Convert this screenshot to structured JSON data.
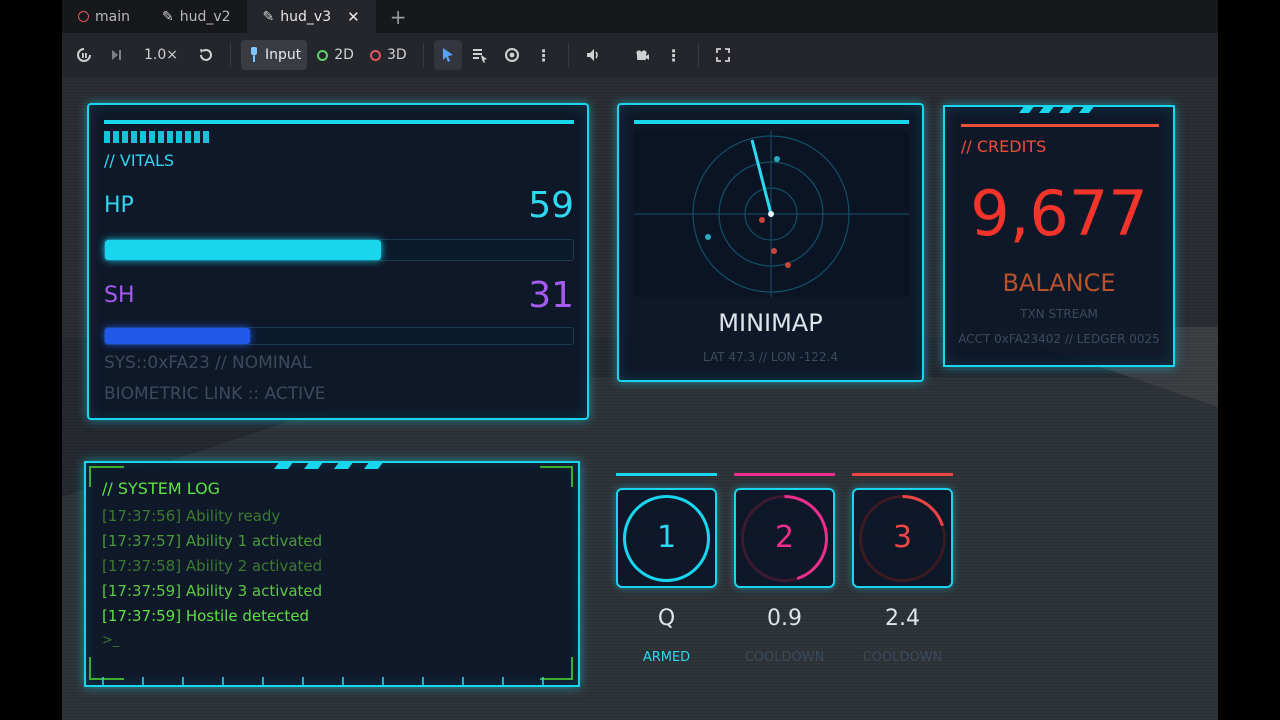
{
  "tabs": [
    {
      "label": "main",
      "icon": "scene-icon"
    },
    {
      "label": "hud_v2",
      "icon": "edit-icon"
    },
    {
      "label": "hud_v3",
      "icon": "edit-icon",
      "active": true
    }
  ],
  "toolbar": {
    "zoom": "1.0×",
    "input_label": "Input",
    "mode_2d": "2D",
    "mode_3d": "3D"
  },
  "colors": {
    "accent": "#19d5ee",
    "hp": "#19d5ee",
    "shield": "#8f49e8",
    "credits": "#f2342a",
    "log_green": "#5fe045",
    "ability2": "#ee2e8d",
    "ability3": "#ec4546"
  },
  "vitals": {
    "label": "// VITALS",
    "hp_label": "HP",
    "hp_value": "59",
    "hp_fraction": 0.59,
    "sh_label": "SH",
    "sh_value": "31",
    "sh_fraction": 0.31,
    "sys_line": "SYS::0xFA23 // NOMINAL",
    "bio_line": "BIOMETRIC LINK :: ACTIVE"
  },
  "minimap": {
    "title": "MINIMAP",
    "coords": "LAT 47.3  //  LON -122.4"
  },
  "credits": {
    "label": "// CREDITS",
    "amount": "9,677",
    "balance_label": "BALANCE",
    "stream": "TXN STREAM",
    "account": "ACCT 0xFA23402 // LEDGER 0025"
  },
  "system_log": {
    "label": "// SYSTEM LOG",
    "lines": [
      "[17:37:56] Ability ready",
      "[17:37:57] Ability 1 activated",
      "[17:37:58] Ability 2 activated",
      "[17:37:59] Ability 3 activated",
      "[17:37:59] Hostile detected"
    ],
    "prompt": ">_"
  },
  "abilities": [
    {
      "number": "1",
      "key": "Q",
      "state": "ARMED",
      "progress": 1.0
    },
    {
      "number": "2",
      "key": "0.9",
      "state": "COOLDOWN",
      "progress": 0.45
    },
    {
      "number": "3",
      "key": "2.4",
      "state": "COOLDOWN",
      "progress": 0.2
    }
  ]
}
